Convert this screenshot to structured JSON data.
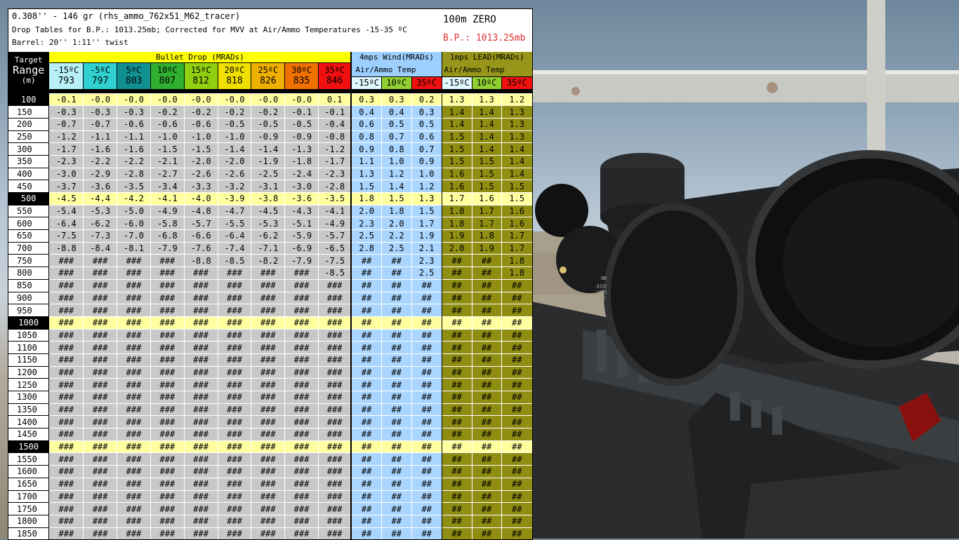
{
  "header": {
    "line1": "0.308'' - 146 gr (rhs_ammo_762x51_M62_tracer)",
    "line2": "Drop Tables for B.P.: 1013.25mb; Corrected for MVV at Air/Ammo Temperatures -15-35 ºC",
    "line3": "Barrel: 20'' 1:11'' twist",
    "zero": "100m ZERO",
    "bp": "B.P.: 1013.25mb"
  },
  "columns": {
    "target_line1": "Target",
    "target_line2": "Range",
    "target_line3": "(m)",
    "drop_group": "Bullet Drop (MRADs)",
    "wind_group": "4mps Wind(MRADs)",
    "lead_group": "1mps LEAD(MRADs)",
    "wind_sub": "Air/Ammo Temp",
    "lead_sub": "Air/Ammo Temp",
    "drop_temps": [
      {
        "t": "-15ºC",
        "v": "793",
        "bg": "#b8f0f8"
      },
      {
        "t": "-5ºC",
        "v": "797",
        "bg": "#30d0d0"
      },
      {
        "t": "5ºC",
        "v": "803",
        "bg": "#109090"
      },
      {
        "t": "10ºC",
        "v": "807",
        "bg": "#30b030"
      },
      {
        "t": "15ºC",
        "v": "812",
        "bg": "#90d010"
      },
      {
        "t": "20ºC",
        "v": "818",
        "bg": "#f0e000"
      },
      {
        "t": "25ºC",
        "v": "826",
        "bg": "#f0b000"
      },
      {
        "t": "30ºC",
        "v": "835",
        "bg": "#f07000"
      },
      {
        "t": "35ºC",
        "v": "846",
        "bg": "#f01010"
      }
    ],
    "wind_temps": [
      {
        "t": "-15ºC",
        "bg": "#e0f8ff"
      },
      {
        "t": "10ºC",
        "bg": "#90d030"
      },
      {
        "t": "35ºC",
        "bg": "#f01010"
      }
    ],
    "lead_temps": [
      {
        "t": "-15ºC",
        "bg": "#e0f8ff"
      },
      {
        "t": "10ºC",
        "bg": "#90d030"
      },
      {
        "t": "35ºC",
        "bg": "#f01010"
      }
    ]
  },
  "rows": [
    {
      "r": "100",
      "hi": true,
      "drop": [
        "-0.1",
        "-0.0",
        "-0.0",
        "-0.0",
        "-0.0",
        "-0.0",
        "-0.0",
        "-0.0",
        "0.1"
      ],
      "wind": [
        "0.3",
        "0.3",
        "0.2"
      ],
      "lead": [
        "1.3",
        "1.3",
        "1.2"
      ]
    },
    {
      "r": "150",
      "drop": [
        "-0.3",
        "-0.3",
        "-0.3",
        "-0.2",
        "-0.2",
        "-0.2",
        "-0.2",
        "-0.1",
        "-0.1"
      ],
      "wind": [
        "0.4",
        "0.4",
        "0.3"
      ],
      "lead": [
        "1.4",
        "1.4",
        "1.3"
      ]
    },
    {
      "r": "200",
      "drop": [
        "-0.7",
        "-0.7",
        "-0.6",
        "-0.6",
        "-0.6",
        "-0.5",
        "-0.5",
        "-0.5",
        "-0.4"
      ],
      "wind": [
        "0.6",
        "0.5",
        "0.5"
      ],
      "lead": [
        "1.4",
        "1.4",
        "1.3"
      ]
    },
    {
      "r": "250",
      "drop": [
        "-1.2",
        "-1.1",
        "-1.1",
        "-1.0",
        "-1.0",
        "-1.0",
        "-0.9",
        "-0.9",
        "-0.8"
      ],
      "wind": [
        "0.8",
        "0.7",
        "0.6"
      ],
      "lead": [
        "1.5",
        "1.4",
        "1.3"
      ]
    },
    {
      "r": "300",
      "drop": [
        "-1.7",
        "-1.6",
        "-1.6",
        "-1.5",
        "-1.5",
        "-1.4",
        "-1.4",
        "-1.3",
        "-1.2"
      ],
      "wind": [
        "0.9",
        "0.8",
        "0.7"
      ],
      "lead": [
        "1.5",
        "1.4",
        "1.4"
      ]
    },
    {
      "r": "350",
      "drop": [
        "-2.3",
        "-2.2",
        "-2.2",
        "-2.1",
        "-2.0",
        "-2.0",
        "-1.9",
        "-1.8",
        "-1.7"
      ],
      "wind": [
        "1.1",
        "1.0",
        "0.9"
      ],
      "lead": [
        "1.5",
        "1.5",
        "1.4"
      ]
    },
    {
      "r": "400",
      "drop": [
        "-3.0",
        "-2.9",
        "-2.8",
        "-2.7",
        "-2.6",
        "-2.6",
        "-2.5",
        "-2.4",
        "-2.3"
      ],
      "wind": [
        "1.3",
        "1.2",
        "1.0"
      ],
      "lead": [
        "1.6",
        "1.5",
        "1.4"
      ]
    },
    {
      "r": "450",
      "drop": [
        "-3.7",
        "-3.6",
        "-3.5",
        "-3.4",
        "-3.3",
        "-3.2",
        "-3.1",
        "-3.0",
        "-2.8"
      ],
      "wind": [
        "1.5",
        "1.4",
        "1.2"
      ],
      "lead": [
        "1.6",
        "1.5",
        "1.5"
      ]
    },
    {
      "r": "500",
      "hi": true,
      "drop": [
        "-4.5",
        "-4.4",
        "-4.2",
        "-4.1",
        "-4.0",
        "-3.9",
        "-3.8",
        "-3.6",
        "-3.5"
      ],
      "wind": [
        "1.8",
        "1.5",
        "1.3"
      ],
      "lead": [
        "1.7",
        "1.6",
        "1.5"
      ]
    },
    {
      "r": "550",
      "drop": [
        "-5.4",
        "-5.3",
        "-5.0",
        "-4.9",
        "-4.8",
        "-4.7",
        "-4.5",
        "-4.3",
        "-4.1"
      ],
      "wind": [
        "2.0",
        "1.8",
        "1.5"
      ],
      "lead": [
        "1.8",
        "1.7",
        "1.6"
      ]
    },
    {
      "r": "600",
      "drop": [
        "-6.4",
        "-6.2",
        "-6.0",
        "-5.8",
        "-5.7",
        "-5.5",
        "-5.3",
        "-5.1",
        "-4.9"
      ],
      "wind": [
        "2.3",
        "2.0",
        "1.7"
      ],
      "lead": [
        "1.8",
        "1.7",
        "1.6"
      ]
    },
    {
      "r": "650",
      "drop": [
        "-7.5",
        "-7.3",
        "-7.0",
        "-6.8",
        "-6.6",
        "-6.4",
        "-6.2",
        "-5.9",
        "-5.7"
      ],
      "wind": [
        "2.5",
        "2.2",
        "1.9"
      ],
      "lead": [
        "1.9",
        "1.8",
        "1.7"
      ]
    },
    {
      "r": "700",
      "drop": [
        "-8.8",
        "-8.4",
        "-8.1",
        "-7.9",
        "-7.6",
        "-7.4",
        "-7.1",
        "-6.9",
        "-6.5"
      ],
      "wind": [
        "2.8",
        "2.5",
        "2.1"
      ],
      "lead": [
        "2.0",
        "1.9",
        "1.7"
      ]
    },
    {
      "r": "750",
      "drop": [
        "###",
        "###",
        "###",
        "###",
        "-8.8",
        "-8.5",
        "-8.2",
        "-7.9",
        "-7.5"
      ],
      "wind": [
        "##",
        "##",
        "2.3"
      ],
      "lead": [
        "##",
        "##",
        "1.8"
      ]
    },
    {
      "r": "800",
      "drop": [
        "###",
        "###",
        "###",
        "###",
        "###",
        "###",
        "###",
        "###",
        "-8.5"
      ],
      "wind": [
        "##",
        "##",
        "2.5"
      ],
      "lead": [
        "##",
        "##",
        "1.8"
      ]
    },
    {
      "r": "850",
      "drop": [
        "###",
        "###",
        "###",
        "###",
        "###",
        "###",
        "###",
        "###",
        "###"
      ],
      "wind": [
        "##",
        "##",
        "##"
      ],
      "lead": [
        "##",
        "##",
        "##"
      ]
    },
    {
      "r": "900",
      "drop": [
        "###",
        "###",
        "###",
        "###",
        "###",
        "###",
        "###",
        "###",
        "###"
      ],
      "wind": [
        "##",
        "##",
        "##"
      ],
      "lead": [
        "##",
        "##",
        "##"
      ]
    },
    {
      "r": "950",
      "drop": [
        "###",
        "###",
        "###",
        "###",
        "###",
        "###",
        "###",
        "###",
        "###"
      ],
      "wind": [
        "##",
        "##",
        "##"
      ],
      "lead": [
        "##",
        "##",
        "##"
      ]
    },
    {
      "r": "1000",
      "hi": true,
      "drop": [
        "###",
        "###",
        "###",
        "###",
        "###",
        "###",
        "###",
        "###",
        "###"
      ],
      "wind": [
        "##",
        "##",
        "##"
      ],
      "lead": [
        "##",
        "##",
        "##"
      ]
    },
    {
      "r": "1050",
      "drop": [
        "###",
        "###",
        "###",
        "###",
        "###",
        "###",
        "###",
        "###",
        "###"
      ],
      "wind": [
        "##",
        "##",
        "##"
      ],
      "lead": [
        "##",
        "##",
        "##"
      ]
    },
    {
      "r": "1100",
      "drop": [
        "###",
        "###",
        "###",
        "###",
        "###",
        "###",
        "###",
        "###",
        "###"
      ],
      "wind": [
        "##",
        "##",
        "##"
      ],
      "lead": [
        "##",
        "##",
        "##"
      ]
    },
    {
      "r": "1150",
      "drop": [
        "###",
        "###",
        "###",
        "###",
        "###",
        "###",
        "###",
        "###",
        "###"
      ],
      "wind": [
        "##",
        "##",
        "##"
      ],
      "lead": [
        "##",
        "##",
        "##"
      ]
    },
    {
      "r": "1200",
      "drop": [
        "###",
        "###",
        "###",
        "###",
        "###",
        "###",
        "###",
        "###",
        "###"
      ],
      "wind": [
        "##",
        "##",
        "##"
      ],
      "lead": [
        "##",
        "##",
        "##"
      ]
    },
    {
      "r": "1250",
      "drop": [
        "###",
        "###",
        "###",
        "###",
        "###",
        "###",
        "###",
        "###",
        "###"
      ],
      "wind": [
        "##",
        "##",
        "##"
      ],
      "lead": [
        "##",
        "##",
        "##"
      ]
    },
    {
      "r": "1300",
      "drop": [
        "###",
        "###",
        "###",
        "###",
        "###",
        "###",
        "###",
        "###",
        "###"
      ],
      "wind": [
        "##",
        "##",
        "##"
      ],
      "lead": [
        "##",
        "##",
        "##"
      ]
    },
    {
      "r": "1350",
      "drop": [
        "###",
        "###",
        "###",
        "###",
        "###",
        "###",
        "###",
        "###",
        "###"
      ],
      "wind": [
        "##",
        "##",
        "##"
      ],
      "lead": [
        "##",
        "##",
        "##"
      ]
    },
    {
      "r": "1400",
      "drop": [
        "###",
        "###",
        "###",
        "###",
        "###",
        "###",
        "###",
        "###",
        "###"
      ],
      "wind": [
        "##",
        "##",
        "##"
      ],
      "lead": [
        "##",
        "##",
        "##"
      ]
    },
    {
      "r": "1450",
      "drop": [
        "###",
        "###",
        "###",
        "###",
        "###",
        "###",
        "###",
        "###",
        "###"
      ],
      "wind": [
        "##",
        "##",
        "##"
      ],
      "lead": [
        "##",
        "##",
        "##"
      ]
    },
    {
      "r": "1500",
      "hi": true,
      "drop": [
        "###",
        "###",
        "###",
        "###",
        "###",
        "###",
        "###",
        "###",
        "###"
      ],
      "wind": [
        "##",
        "##",
        "##"
      ],
      "lead": [
        "##",
        "##",
        "##"
      ]
    },
    {
      "r": "1550",
      "drop": [
        "###",
        "###",
        "###",
        "###",
        "###",
        "###",
        "###",
        "###",
        "###"
      ],
      "wind": [
        "##",
        "##",
        "##"
      ],
      "lead": [
        "##",
        "##",
        "##"
      ]
    },
    {
      "r": "1600",
      "drop": [
        "###",
        "###",
        "###",
        "###",
        "###",
        "###",
        "###",
        "###",
        "###"
      ],
      "wind": [
        "##",
        "##",
        "##"
      ],
      "lead": [
        "##",
        "##",
        "##"
      ]
    },
    {
      "r": "1650",
      "drop": [
        "###",
        "###",
        "###",
        "###",
        "###",
        "###",
        "###",
        "###",
        "###"
      ],
      "wind": [
        "##",
        "##",
        "##"
      ],
      "lead": [
        "##",
        "##",
        "##"
      ]
    },
    {
      "r": "1700",
      "drop": [
        "###",
        "###",
        "###",
        "###",
        "###",
        "###",
        "###",
        "###",
        "###"
      ],
      "wind": [
        "##",
        "##",
        "##"
      ],
      "lead": [
        "##",
        "##",
        "##"
      ]
    },
    {
      "r": "1750",
      "drop": [
        "###",
        "###",
        "###",
        "###",
        "###",
        "###",
        "###",
        "###",
        "###"
      ],
      "wind": [
        "##",
        "##",
        "##"
      ],
      "lead": [
        "##",
        "##",
        "##"
      ]
    },
    {
      "r": "1800",
      "drop": [
        "###",
        "###",
        "###",
        "###",
        "###",
        "###",
        "###",
        "###",
        "###"
      ],
      "wind": [
        "##",
        "##",
        "##"
      ],
      "lead": [
        "##",
        "##",
        "##"
      ]
    },
    {
      "r": "1850",
      "drop": [
        "###",
        "###",
        "###",
        "###",
        "###",
        "###",
        "###",
        "###",
        "###"
      ],
      "wind": [
        "##",
        "##",
        "##"
      ],
      "lead": [
        "##",
        "##",
        "##"
      ]
    }
  ],
  "scope_markings": {
    "infinity": "∞",
    "elev_400": "400",
    "elev_200": "200",
    "elev_150": "150"
  }
}
